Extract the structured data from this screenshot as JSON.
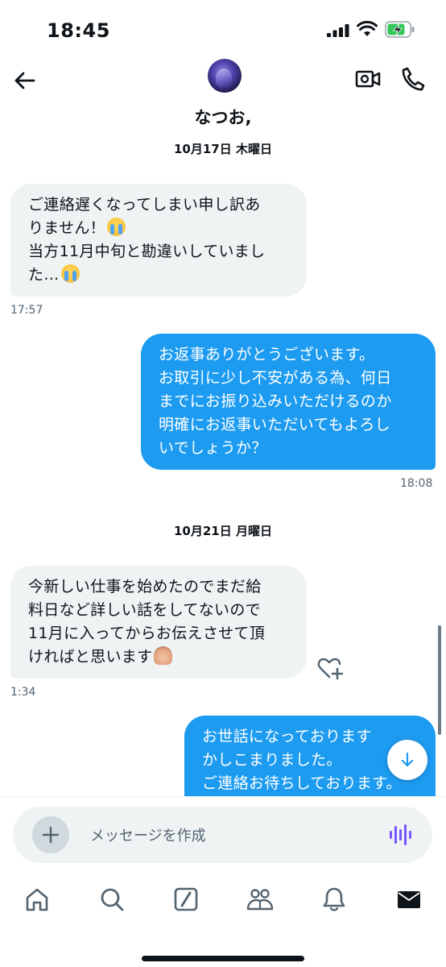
{
  "status_bar": {
    "time": "18:45"
  },
  "header": {
    "contact_name": "なつお,"
  },
  "dates": [
    "10月17日 木曜日",
    "10月21日 月曜日"
  ],
  "messages": [
    {
      "direction": "in",
      "lines": [
        "ご連絡遅くなってしまい申し訳あ",
        "りません！",
        "当方11月中旬と勘違いしていまし",
        "た…"
      ],
      "time": "17:57"
    },
    {
      "direction": "out",
      "lines": [
        "お返事ありがとうございます。",
        "お取引に少し不安がある為、何日",
        "までにお振り込みいただけるのか",
        "明確にお返事いただいてもよろし",
        "いでしょうか？"
      ],
      "time": "18:08"
    },
    {
      "direction": "in",
      "lines": [
        "今新しい仕事を始めたのでまだ給",
        "料日など詳しい話をしてないので",
        "11月に入ってからお伝えさせて頂",
        "ければと思います"
      ],
      "time": "1:34"
    },
    {
      "direction": "out",
      "lines": [
        "お世話になっております",
        "かしこまりました。",
        "ご連絡お待ちしております。"
      ],
      "time": ""
    }
  ],
  "composer": {
    "placeholder": "メッセージを作成"
  },
  "tabs": [
    "home",
    "search",
    "grok",
    "communities",
    "notifications",
    "messages"
  ],
  "colors": {
    "accent": "#1d9bf0",
    "incoming_bubble": "#eff3f4",
    "voice_icon": "#7856ff"
  }
}
